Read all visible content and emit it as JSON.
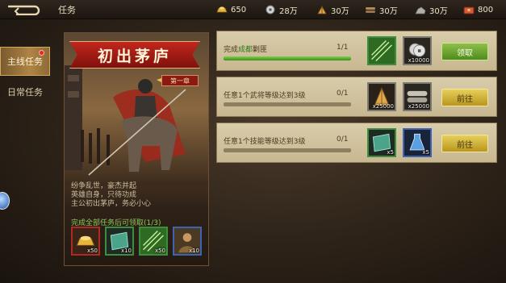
{
  "header": {
    "title": "任务",
    "resources": [
      {
        "icon": "gold-ingot-icon",
        "value": "650",
        "color": "#e7b43c"
      },
      {
        "icon": "silver-coin-icon",
        "value": "28万",
        "color": "#d6d6d6"
      },
      {
        "icon": "grain-icon",
        "value": "30万",
        "color": "#e0a84a"
      },
      {
        "icon": "wood-icon",
        "value": "30万",
        "color": "#b08a5a"
      },
      {
        "icon": "stone-icon",
        "value": "30万",
        "color": "#b0b0a8"
      },
      {
        "icon": "treasure-chest-icon",
        "value": "800",
        "color": "#d85a3a"
      }
    ]
  },
  "sidebar": {
    "tabs": [
      {
        "label": "主线任务",
        "active": true,
        "badge": true
      },
      {
        "label": "日常任务",
        "active": false,
        "badge": false
      }
    ]
  },
  "story": {
    "title": "初出茅庐",
    "chapter": "第一章",
    "lines": [
      "纷争乱世，豪杰并起",
      "英雄自身，只待功成",
      "主公初出茅庐，务必小心"
    ],
    "complete_label": "完成全部任务后可领取",
    "complete_progress": "(1/3)",
    "rewards": [
      {
        "icon": "gold-ingot-icon",
        "qty": "x50",
        "rarity": "red"
      },
      {
        "icon": "jade-scroll-icon",
        "qty": "x10",
        "rarity": "green"
      },
      {
        "icon": "arrows-icon",
        "qty": "x50",
        "rarity": "green"
      },
      {
        "icon": "general-portrait-icon",
        "qty": "x10",
        "rarity": "blue"
      }
    ]
  },
  "quests": [
    {
      "title_pre": "完成",
      "title_hl": "成都",
      "title_post": "剿匪",
      "progress": "1/1",
      "progress_fraction": 1.0,
      "button": "领取",
      "button_type": "claim",
      "rewards": [
        {
          "icon": "arrows-icon",
          "qty": "",
          "rarity": "green"
        },
        {
          "icon": "silver-coin-icon",
          "qty": "x10000",
          "rarity": "gray"
        }
      ]
    },
    {
      "title_pre": "任意1个武将等级达到3级",
      "title_hl": "",
      "title_post": "",
      "progress": "0/1",
      "progress_fraction": 0.0,
      "button": "前往",
      "button_type": "goto",
      "rewards": [
        {
          "icon": "grain-icon",
          "qty": "x25000",
          "rarity": "gray"
        },
        {
          "icon": "wood-icon",
          "qty": "x25000",
          "rarity": "gray"
        }
      ]
    },
    {
      "title_pre": "任意1个技能等级达到3级",
      "title_hl": "",
      "title_post": "",
      "progress": "0/1",
      "progress_fraction": 0.0,
      "button": "前往",
      "button_type": "goto",
      "rewards": [
        {
          "icon": "jade-scroll-icon",
          "qty": "x5",
          "rarity": "green"
        },
        {
          "icon": "skill-potion-icon",
          "qty": "x5",
          "rarity": "blue"
        }
      ]
    }
  ]
}
